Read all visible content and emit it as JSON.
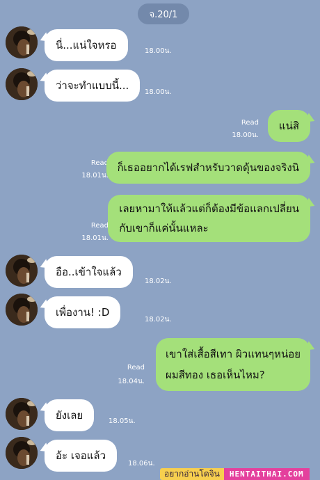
{
  "date_label": "จ.20/1",
  "messages": [
    {
      "side": "in",
      "text": "นี่...แน่ใจหรอ",
      "time": "18.00น."
    },
    {
      "side": "in",
      "text": "ว่าจะทำแบบนี้...",
      "time": "18.00น."
    },
    {
      "side": "out",
      "text": "แน่สิ",
      "read": "Read",
      "time": "18.00น."
    },
    {
      "side": "out",
      "text": "ก็เธออยากได้เรฟสำหรับวาดดุ้นของจริงนิ",
      "read": "Read",
      "time": "18.01น."
    },
    {
      "side": "out",
      "lines": [
        "เลยหามาให้แล้วแต่ก็ต้องมีข้อแลกเปลี่ยน",
        "กับเขาก็แค่นั้นแหละ"
      ],
      "read": "Read",
      "time": "18.01น."
    },
    {
      "side": "in",
      "text": "อือ..เข้าใจแล้ว",
      "time": "18.02น."
    },
    {
      "side": "in",
      "text": "เพื่องาน! :D",
      "time": "18.02น."
    },
    {
      "side": "out",
      "lines": [
        "เขาใส่เสื้อสีเทา ผิวแทนๆหน่อย",
        "ผมสีทอง เธอเห็นไหม?"
      ],
      "read": "Read",
      "time": "18.04น."
    },
    {
      "side": "in",
      "text": "ยังเลย",
      "time": "18.05น."
    },
    {
      "side": "in",
      "text": "อ้ะ เจอแล้ว",
      "time": "18.06น."
    }
  ],
  "banner": {
    "left_text": "อยากอ่านโดจิน",
    "right_text": "HENTAITHAI.COM"
  }
}
